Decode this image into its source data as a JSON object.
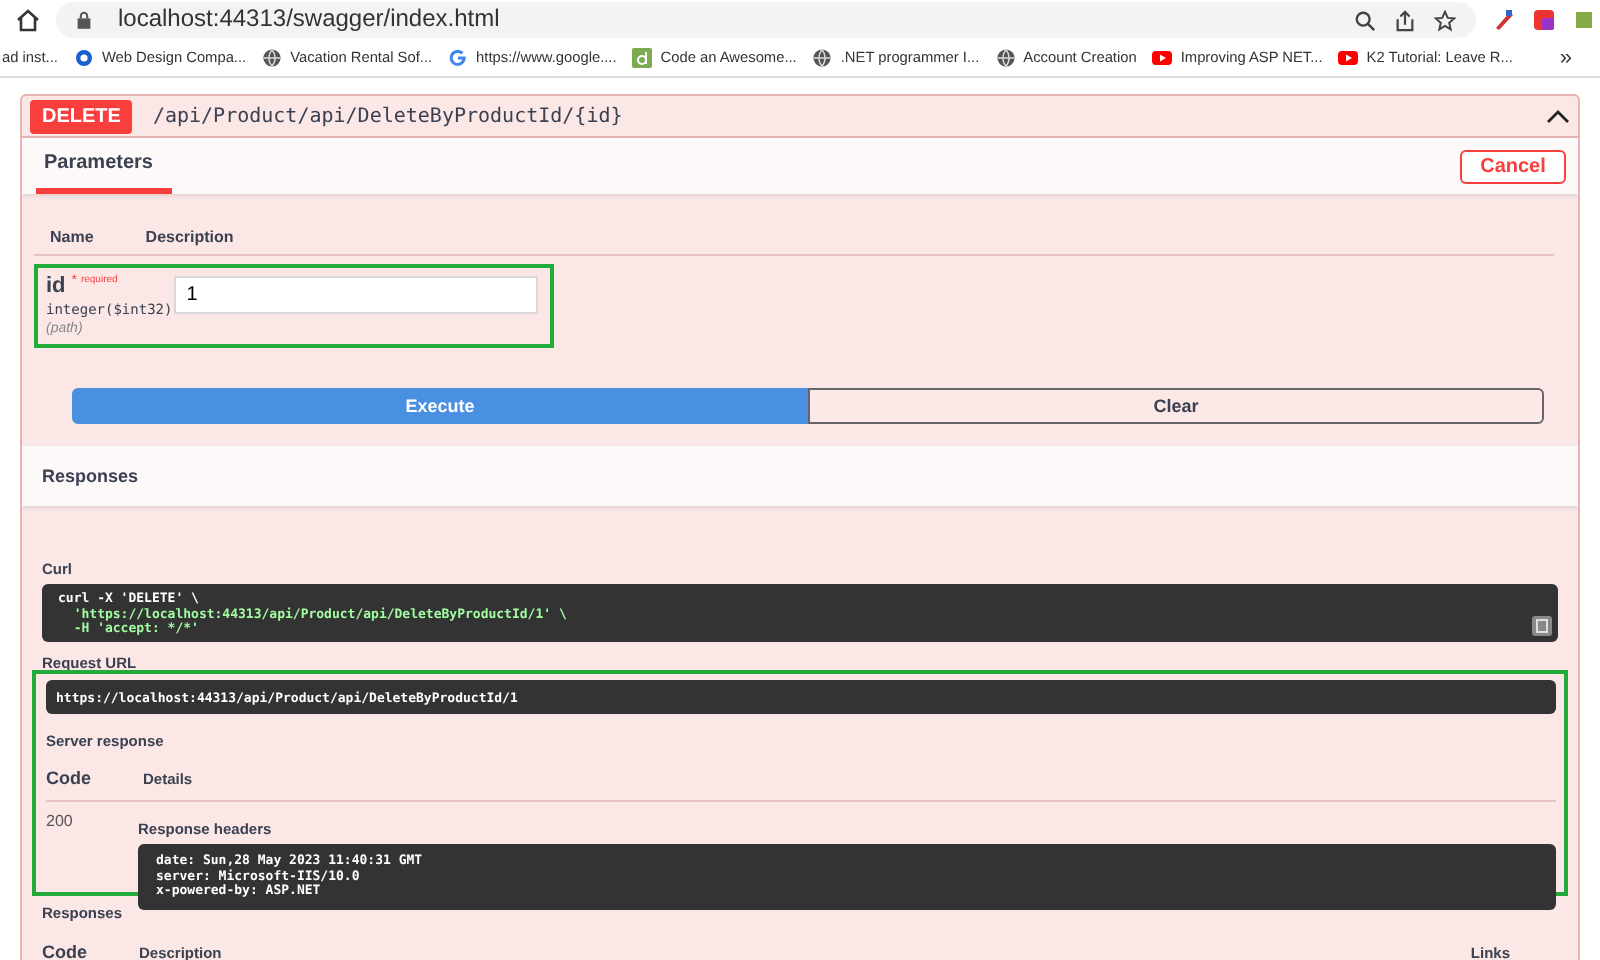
{
  "browser": {
    "url": "localhost:44313/swagger/index.html",
    "bookmarks": [
      {
        "label": "ad inst...",
        "kind": "plain"
      },
      {
        "label": "Web Design Compa...",
        "kind": "logo"
      },
      {
        "label": "Vacation Rental Sof...",
        "kind": "globe"
      },
      {
        "label": "https://www.google....",
        "kind": "google"
      },
      {
        "label": "Code an Awesome...",
        "kind": "square"
      },
      {
        "label": ".NET programmer I...",
        "kind": "globe"
      },
      {
        "label": "Account Creation",
        "kind": "globe"
      },
      {
        "label": "Improving ASP NET...",
        "kind": "video"
      },
      {
        "label": "K2 Tutorial: Leave R...",
        "kind": "video"
      }
    ],
    "more": "»"
  },
  "operation": {
    "method": "DELETE",
    "path": "/api/Product/api/DeleteByProductId/{id}",
    "expanded": true,
    "tabs": [
      {
        "label": "Parameters",
        "selected": true
      }
    ],
    "cancel": "Cancel",
    "param_columns": [
      "Name",
      "Description"
    ],
    "parameters": [
      {
        "name": "id",
        "required_mark": "*",
        "required_label": "required",
        "type": "integer($int32)",
        "location": "(path)",
        "value": "1",
        "highlighted": true
      }
    ],
    "buttons": [
      {
        "label": "Execute",
        "kind": "primary"
      },
      {
        "label": "Clear",
        "kind": "secondary"
      }
    ],
    "responses_title": "Responses",
    "curl_label": "Curl",
    "curl_lines": [
      "curl -X 'DELETE' \\",
      "  'https://localhost:44313/api/Product/api/DeleteByProductId/1' \\",
      "  -H 'accept: */*'"
    ],
    "live": {
      "highlighted": true,
      "request_url_label": "Request URL",
      "request_url": "https://localhost:44313/api/Product/api/DeleteByProductId/1",
      "server_response_label": "Server response",
      "columns": [
        "Code",
        "Details"
      ],
      "rows": [
        {
          "code": "200",
          "headers_label": "Response headers",
          "headers": [
            "date: Sun,28 May 2023 11:40:31 GMT",
            "server: Microsoft-IIS/10.0",
            "x-powered-by: ASP.NET"
          ]
        }
      ]
    },
    "responses_label": "Responses",
    "response_columns": [
      "Code",
      "Description",
      "Links"
    ]
  }
}
